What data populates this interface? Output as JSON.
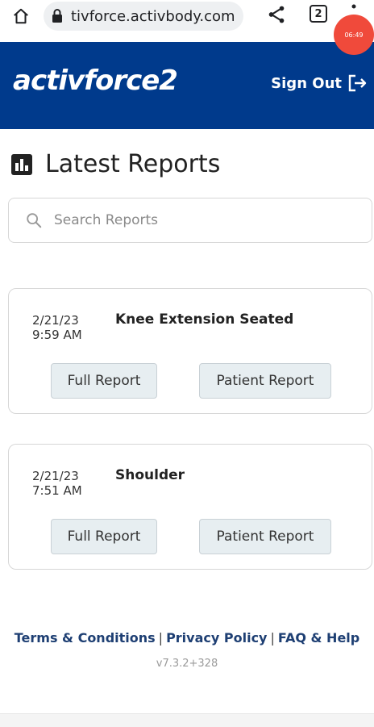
{
  "browser": {
    "url": "tivforce.activbody.com",
    "tab_count": "2",
    "recording_timer": "06:49"
  },
  "header": {
    "logo_text": "activforce2",
    "sign_out_label": "Sign Out"
  },
  "page": {
    "title": "Latest Reports"
  },
  "search": {
    "placeholder": "Search Reports"
  },
  "reports": [
    {
      "date": "2/21/23",
      "time": "9:59 AM",
      "title": "Knee Extension Seated",
      "full_report_label": "Full Report",
      "patient_report_label": "Patient Report"
    },
    {
      "date": "2/21/23",
      "time": "7:51 AM",
      "title": "Shoulder",
      "full_report_label": "Full Report",
      "patient_report_label": "Patient Report"
    }
  ],
  "footer": {
    "terms_label": "Terms & Conditions",
    "privacy_label": "Privacy Policy",
    "faq_label": "FAQ & Help",
    "separator": "|",
    "version": "v7.3.2+328"
  },
  "colors": {
    "header_bg": "#003a8c",
    "link": "#1e3f73",
    "button_bg": "#e7eef1",
    "record_badge": "#f04a3b"
  }
}
